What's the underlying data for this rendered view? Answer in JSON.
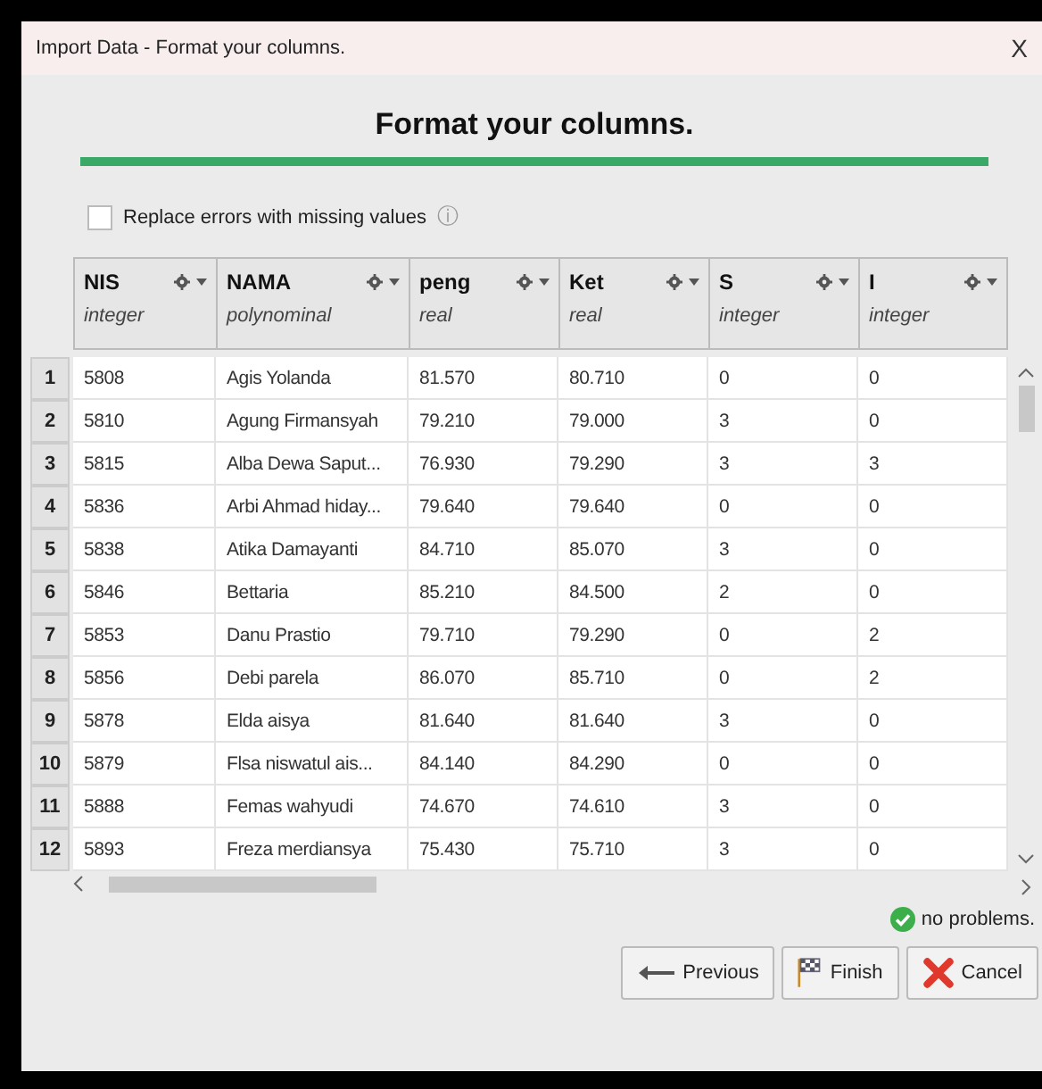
{
  "window": {
    "title": "Import Data - Format your columns.",
    "close": "X"
  },
  "heading": "Format your columns.",
  "progress": {
    "level": 1
  },
  "replace_errors": {
    "label": "Replace errors with missing values",
    "checked": false,
    "info": "ⓘ"
  },
  "table": {
    "columns": [
      {
        "name": "NIS",
        "type": "integer"
      },
      {
        "name": "NAMA",
        "type": "polynominal"
      },
      {
        "name": "peng",
        "type": "real"
      },
      {
        "name": "Ket",
        "type": "real"
      },
      {
        "name": "S",
        "type": "integer"
      },
      {
        "name": "I",
        "type": "integer"
      }
    ],
    "rows": [
      {
        "index": "1",
        "cells": [
          "5808",
          "Agis Yolanda",
          "81.570",
          "80.710",
          "0",
          "0"
        ]
      },
      {
        "index": "2",
        "cells": [
          "5810",
          "Agung Firmansyah",
          "79.210",
          "79.000",
          "3",
          "0"
        ]
      },
      {
        "index": "3",
        "cells": [
          "5815",
          "Alba Dewa Saput...",
          "76.930",
          "79.290",
          "3",
          "3"
        ]
      },
      {
        "index": "4",
        "cells": [
          "5836",
          "Arbi Ahmad hiday...",
          "79.640",
          "79.640",
          "0",
          "0"
        ]
      },
      {
        "index": "5",
        "cells": [
          "5838",
          "Atika Damayanti",
          "84.710",
          "85.070",
          "3",
          "0"
        ]
      },
      {
        "index": "6",
        "cells": [
          "5846",
          "Bettaria",
          "85.210",
          "84.500",
          "2",
          "0"
        ]
      },
      {
        "index": "7",
        "cells": [
          "5853",
          "Danu Prastio",
          "79.710",
          "79.290",
          "0",
          "2"
        ]
      },
      {
        "index": "8",
        "cells": [
          "5856",
          "Debi parela",
          "86.070",
          "85.710",
          "0",
          "2"
        ]
      },
      {
        "index": "9",
        "cells": [
          "5878",
          "Elda aisya",
          "81.640",
          "81.640",
          "3",
          "0"
        ]
      },
      {
        "index": "10",
        "cells": [
          "5879",
          "Flsa niswatul ais...",
          "84.140",
          "84.290",
          "0",
          "0"
        ]
      },
      {
        "index": "11",
        "cells": [
          "5888",
          "Femas wahyudi",
          "74.670",
          "74.610",
          "3",
          "0"
        ]
      },
      {
        "index": "12",
        "cells": [
          "5893",
          "Freza merdiansya",
          "75.430",
          "75.710",
          "3",
          "0"
        ]
      }
    ]
  },
  "status": "no problems.",
  "buttons": [
    {
      "kind": "previous",
      "label": "Previous"
    },
    {
      "kind": "finish",
      "label": "Finish"
    },
    {
      "kind": "cancel",
      "label": "Cancel"
    }
  ]
}
